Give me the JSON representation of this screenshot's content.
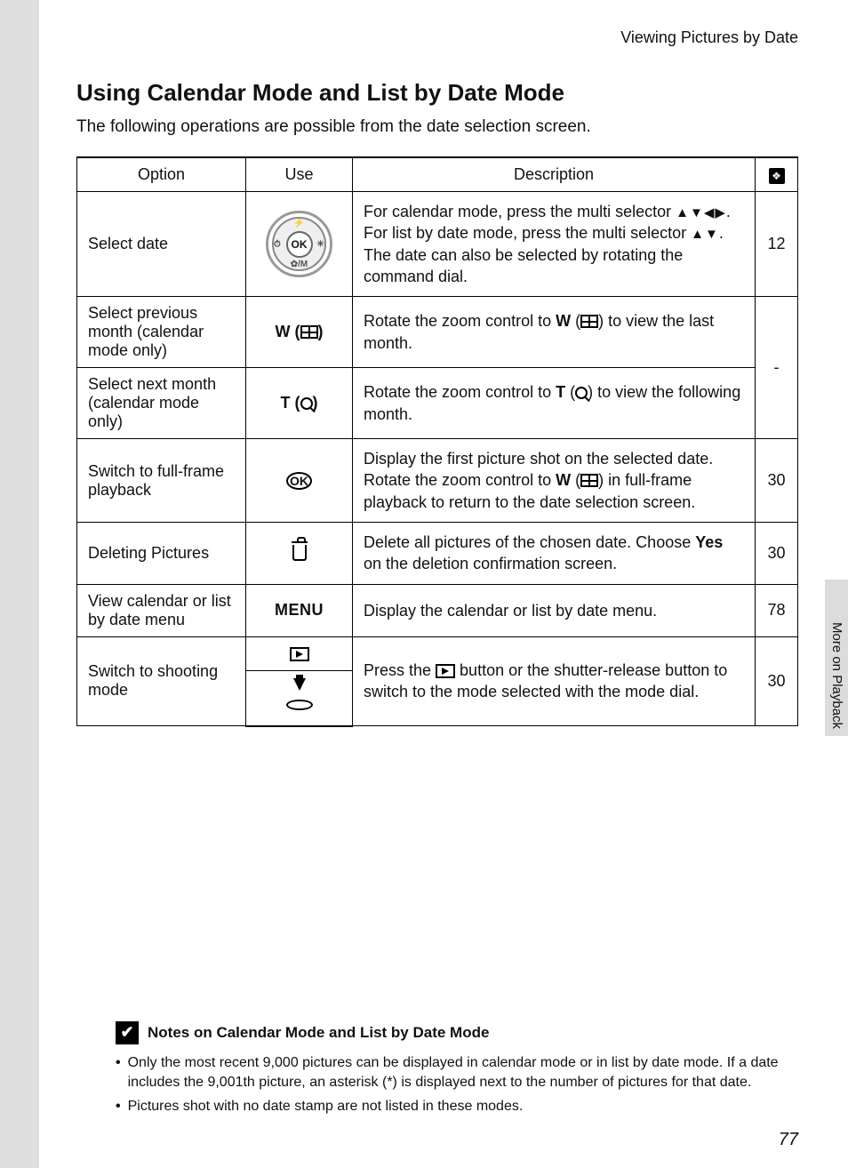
{
  "header": {
    "section": "Viewing Pictures by Date"
  },
  "title": "Using Calendar Mode and List by Date Mode",
  "intro": "The following operations are possible from the date selection screen.",
  "table": {
    "headers": {
      "option": "Option",
      "use": "Use",
      "description": "Description"
    },
    "rows": {
      "r1": {
        "option": "Select date",
        "desc_a": "For calendar mode, press the multi selector ",
        "desc_arrows4": "▲▼◀▶",
        "desc_b": ".",
        "desc_c": "For list by date mode, press the multi selector ",
        "desc_arrows2": "▲▼",
        "desc_d": ".",
        "desc_e": "The date can also be selected by rotating the command dial.",
        "page": "12"
      },
      "r2": {
        "option": "Select previous month (calendar mode only)",
        "use_prefix": "W",
        "desc_a": "Rotate the zoom control to ",
        "desc_sym": "W",
        "desc_b": " (",
        "desc_c": ") to view the last month."
      },
      "r3": {
        "option": "Select next month (calendar mode only)",
        "use_prefix": "T",
        "desc_a": "Rotate the zoom control to ",
        "desc_sym": "T",
        "desc_b": " (",
        "desc_c": ") to view the following month."
      },
      "r23_page": "-",
      "r4": {
        "option": "Switch to full-frame playback",
        "desc_a": "Display the first picture shot on the selected date.",
        "desc_b": "Rotate the zoom control to ",
        "desc_sym": "W",
        "desc_c": " (",
        "desc_d": ") in full-frame playback to return to the date selection screen.",
        "page": "30"
      },
      "r5": {
        "option": "Deleting Pictures",
        "desc_a": "Delete all pictures of the chosen date. Choose ",
        "desc_yes": "Yes",
        "desc_b": " on the deletion confirmation screen.",
        "page": "30"
      },
      "r6": {
        "option": "View calendar or list by date menu",
        "use": "MENU",
        "desc": "Display the calendar or list by date menu.",
        "page": "78"
      },
      "r7": {
        "option": "Switch to shooting mode",
        "desc_a": "Press the ",
        "desc_b": " button or the shutter-release button to switch to the mode selected with the mode dial.",
        "page": "30"
      }
    }
  },
  "sidebar": {
    "label": "More on Playback"
  },
  "notes": {
    "heading": "Notes on Calendar Mode and List by Date Mode",
    "items": {
      "n1": "Only the most recent 9,000 pictures can be displayed in calendar mode or in list by date mode. If a date includes the 9,001th picture, an asterisk (*) is displayed next to the number of pictures for that date.",
      "n2": "Pictures shot with no date stamp are not listed in these modes."
    }
  },
  "page_number": "77",
  "ok_label": "OK"
}
